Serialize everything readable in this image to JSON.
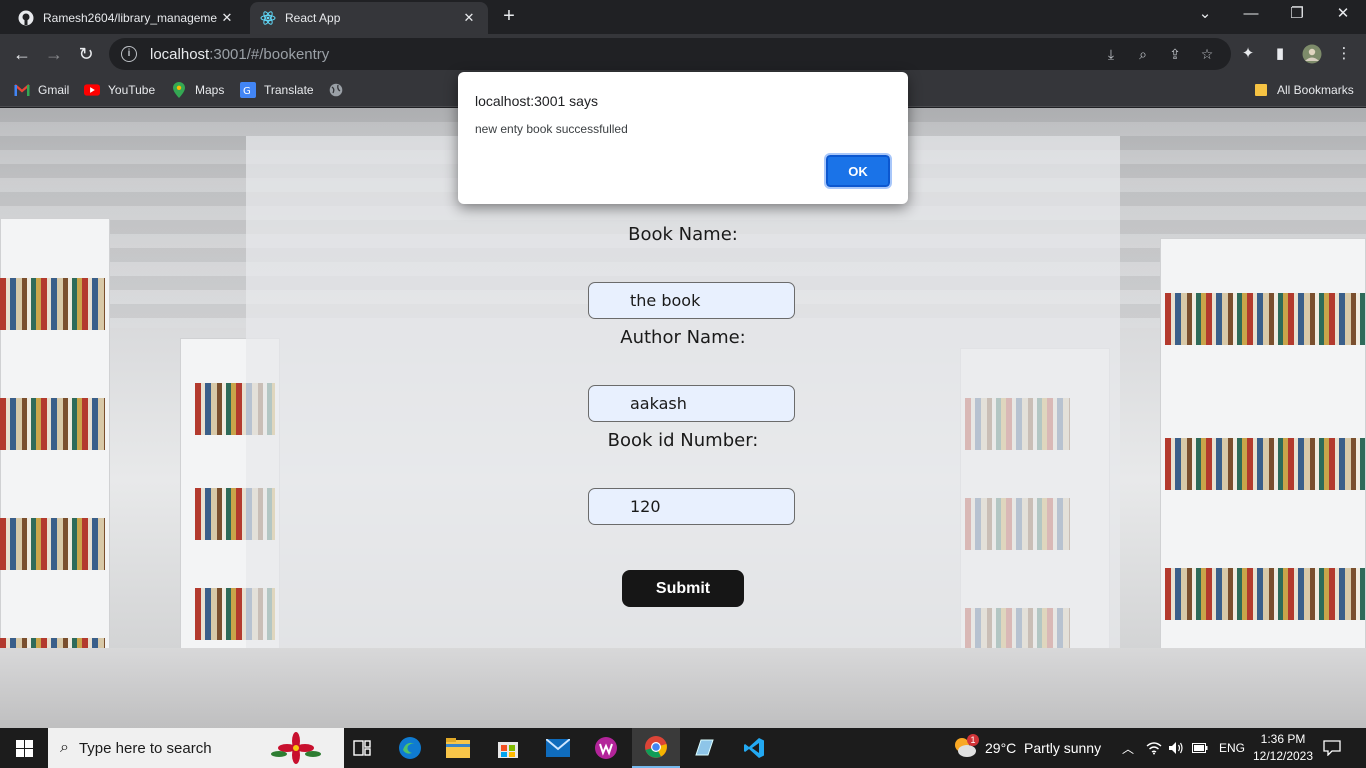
{
  "browser": {
    "tabs": [
      {
        "title": "Ramesh2604/library_manageme",
        "active": false
      },
      {
        "title": "React App",
        "active": true
      }
    ],
    "url_host": "localhost",
    "url_rest": ":3001/#/bookentry",
    "bookmarks": [
      "Gmail",
      "YouTube",
      "Maps",
      "Translate"
    ],
    "all_bookmarks": "All Bookmarks"
  },
  "dialog": {
    "title": "localhost:3001 says",
    "message": "new enty book successfulled",
    "ok_label": "OK"
  },
  "form": {
    "book_name_label": "Book Name:",
    "book_name_value": "the book",
    "author_name_label": "Author Name:",
    "author_name_value": "aakash",
    "book_id_label": "Book id Number:",
    "book_id_value": "120",
    "submit_label": "Submit"
  },
  "taskbar": {
    "search_placeholder": "Type here to search",
    "weather": "29°C  Partly sunny",
    "language": "ENG",
    "time": "1:36 PM",
    "date": "12/12/2023",
    "weather_badge": "1"
  },
  "colors": {
    "accent": "#1a73e8",
    "submit_bg": "#161616",
    "input_bg": "#e8f0fe"
  }
}
